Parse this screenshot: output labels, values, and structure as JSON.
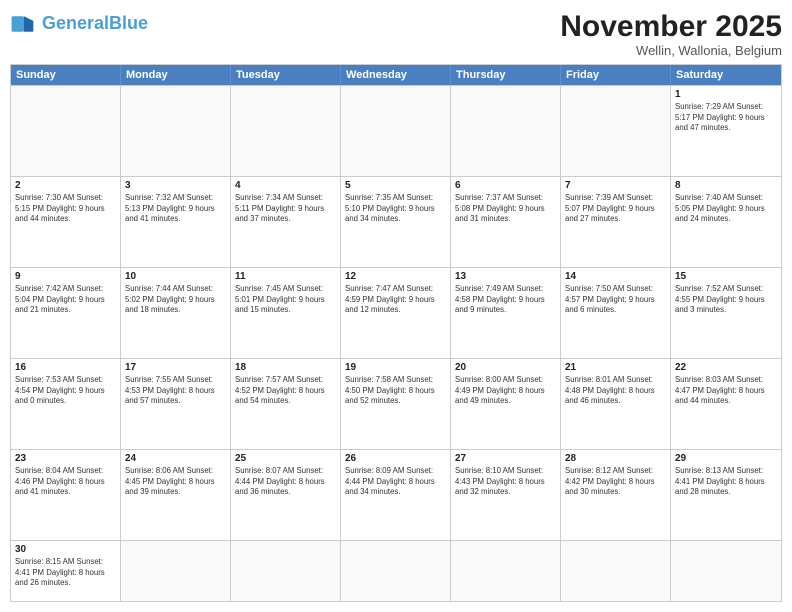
{
  "logo": {
    "text_general": "General",
    "text_blue": "Blue"
  },
  "title": "November 2025",
  "location": "Wellin, Wallonia, Belgium",
  "header_days": [
    "Sunday",
    "Monday",
    "Tuesday",
    "Wednesday",
    "Thursday",
    "Friday",
    "Saturday"
  ],
  "weeks": [
    [
      {
        "day": "",
        "info": ""
      },
      {
        "day": "",
        "info": ""
      },
      {
        "day": "",
        "info": ""
      },
      {
        "day": "",
        "info": ""
      },
      {
        "day": "",
        "info": ""
      },
      {
        "day": "",
        "info": ""
      },
      {
        "day": "1",
        "info": "Sunrise: 7:29 AM\nSunset: 5:17 PM\nDaylight: 9 hours and 47 minutes."
      }
    ],
    [
      {
        "day": "2",
        "info": "Sunrise: 7:30 AM\nSunset: 5:15 PM\nDaylight: 9 hours and 44 minutes."
      },
      {
        "day": "3",
        "info": "Sunrise: 7:32 AM\nSunset: 5:13 PM\nDaylight: 9 hours and 41 minutes."
      },
      {
        "day": "4",
        "info": "Sunrise: 7:34 AM\nSunset: 5:11 PM\nDaylight: 9 hours and 37 minutes."
      },
      {
        "day": "5",
        "info": "Sunrise: 7:35 AM\nSunset: 5:10 PM\nDaylight: 9 hours and 34 minutes."
      },
      {
        "day": "6",
        "info": "Sunrise: 7:37 AM\nSunset: 5:08 PM\nDaylight: 9 hours and 31 minutes."
      },
      {
        "day": "7",
        "info": "Sunrise: 7:39 AM\nSunset: 5:07 PM\nDaylight: 9 hours and 27 minutes."
      },
      {
        "day": "8",
        "info": "Sunrise: 7:40 AM\nSunset: 5:05 PM\nDaylight: 9 hours and 24 minutes."
      }
    ],
    [
      {
        "day": "9",
        "info": "Sunrise: 7:42 AM\nSunset: 5:04 PM\nDaylight: 9 hours and 21 minutes."
      },
      {
        "day": "10",
        "info": "Sunrise: 7:44 AM\nSunset: 5:02 PM\nDaylight: 9 hours and 18 minutes."
      },
      {
        "day": "11",
        "info": "Sunrise: 7:45 AM\nSunset: 5:01 PM\nDaylight: 9 hours and 15 minutes."
      },
      {
        "day": "12",
        "info": "Sunrise: 7:47 AM\nSunset: 4:59 PM\nDaylight: 9 hours and 12 minutes."
      },
      {
        "day": "13",
        "info": "Sunrise: 7:49 AM\nSunset: 4:58 PM\nDaylight: 9 hours and 9 minutes."
      },
      {
        "day": "14",
        "info": "Sunrise: 7:50 AM\nSunset: 4:57 PM\nDaylight: 9 hours and 6 minutes."
      },
      {
        "day": "15",
        "info": "Sunrise: 7:52 AM\nSunset: 4:55 PM\nDaylight: 9 hours and 3 minutes."
      }
    ],
    [
      {
        "day": "16",
        "info": "Sunrise: 7:53 AM\nSunset: 4:54 PM\nDaylight: 9 hours and 0 minutes."
      },
      {
        "day": "17",
        "info": "Sunrise: 7:55 AM\nSunset: 4:53 PM\nDaylight: 8 hours and 57 minutes."
      },
      {
        "day": "18",
        "info": "Sunrise: 7:57 AM\nSunset: 4:52 PM\nDaylight: 8 hours and 54 minutes."
      },
      {
        "day": "19",
        "info": "Sunrise: 7:58 AM\nSunset: 4:50 PM\nDaylight: 8 hours and 52 minutes."
      },
      {
        "day": "20",
        "info": "Sunrise: 8:00 AM\nSunset: 4:49 PM\nDaylight: 8 hours and 49 minutes."
      },
      {
        "day": "21",
        "info": "Sunrise: 8:01 AM\nSunset: 4:48 PM\nDaylight: 8 hours and 46 minutes."
      },
      {
        "day": "22",
        "info": "Sunrise: 8:03 AM\nSunset: 4:47 PM\nDaylight: 8 hours and 44 minutes."
      }
    ],
    [
      {
        "day": "23",
        "info": "Sunrise: 8:04 AM\nSunset: 4:46 PM\nDaylight: 8 hours and 41 minutes."
      },
      {
        "day": "24",
        "info": "Sunrise: 8:06 AM\nSunset: 4:45 PM\nDaylight: 8 hours and 39 minutes."
      },
      {
        "day": "25",
        "info": "Sunrise: 8:07 AM\nSunset: 4:44 PM\nDaylight: 8 hours and 36 minutes."
      },
      {
        "day": "26",
        "info": "Sunrise: 8:09 AM\nSunset: 4:44 PM\nDaylight: 8 hours and 34 minutes."
      },
      {
        "day": "27",
        "info": "Sunrise: 8:10 AM\nSunset: 4:43 PM\nDaylight: 8 hours and 32 minutes."
      },
      {
        "day": "28",
        "info": "Sunrise: 8:12 AM\nSunset: 4:42 PM\nDaylight: 8 hours and 30 minutes."
      },
      {
        "day": "29",
        "info": "Sunrise: 8:13 AM\nSunset: 4:41 PM\nDaylight: 8 hours and 28 minutes."
      }
    ],
    [
      {
        "day": "30",
        "info": "Sunrise: 8:15 AM\nSunset: 4:41 PM\nDaylight: 8 hours and 26 minutes."
      },
      {
        "day": "",
        "info": ""
      },
      {
        "day": "",
        "info": ""
      },
      {
        "day": "",
        "info": ""
      },
      {
        "day": "",
        "info": ""
      },
      {
        "day": "",
        "info": ""
      },
      {
        "day": "",
        "info": ""
      }
    ]
  ]
}
